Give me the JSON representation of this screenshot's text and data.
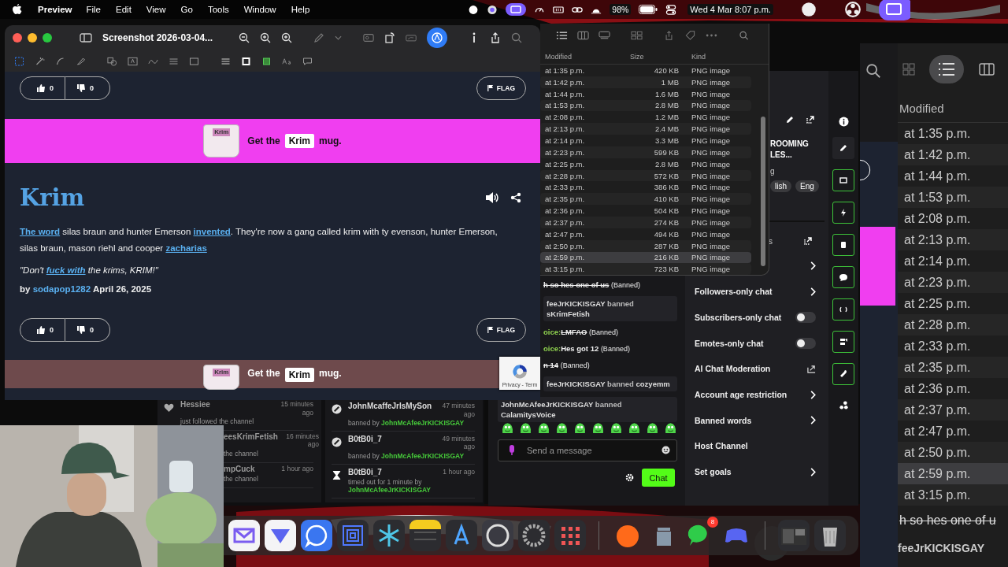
{
  "menubar": {
    "app": "Preview",
    "menus": [
      "File",
      "Edit",
      "View",
      "Go",
      "Tools",
      "Window",
      "Help"
    ],
    "battery": "98%",
    "clock": "Wed 4 Mar  8:07 p.m."
  },
  "preview": {
    "title": "Screenshot 2026-03-04...",
    "top_votes": {
      "up": "0",
      "down": "0",
      "flag": "FLAG"
    },
    "banners": [
      {
        "color": "#f03ef0",
        "lead": "Get the",
        "mug_word": "Krim",
        "word": "Krim",
        "tail": "mug."
      },
      {
        "color": "#6e4a4c",
        "lead": "Get the",
        "mug_word": "Krim",
        "word": "Krim",
        "tail": "mug."
      }
    ],
    "entry": {
      "word": "Krim",
      "definition": [
        {
          "text": "The word",
          "link": true
        },
        {
          "text": " silas braun and hunter Emerson ",
          "link": false
        },
        {
          "text": "invented",
          "link": true
        },
        {
          "text": ". They're now a gang called krim with ty evenson, hunter Emerson, silas braun, mason riehl and cooper ",
          "link": false
        },
        {
          "text": "zacharias",
          "link": true
        }
      ],
      "example": [
        {
          "text": "\"Don't ",
          "link": false
        },
        {
          "text": "fuck with",
          "link": true
        },
        {
          "text": " the krims, KRIM!\"",
          "link": false
        }
      ],
      "by": "by",
      "author": "sodapop1282",
      "date": "April 26, 2025"
    },
    "bottom_votes": {
      "up": "0",
      "down": "0",
      "flag": "FLAG"
    },
    "recaptcha": "Privacy - Term"
  },
  "finder": {
    "columns": [
      "Modified",
      "Size",
      "Kind"
    ],
    "rows": [
      {
        "modified": "at 1:35 p.m.",
        "size": "420 KB",
        "kind": "PNG image",
        "selected": false
      },
      {
        "modified": "at 1:42 p.m.",
        "size": "1 MB",
        "kind": "PNG image",
        "selected": false
      },
      {
        "modified": "at 1:44 p.m.",
        "size": "1.6 MB",
        "kind": "PNG image",
        "selected": false
      },
      {
        "modified": "at 1:53 p.m.",
        "size": "2.8 MB",
        "kind": "PNG image",
        "selected": false
      },
      {
        "modified": "at 2:08 p.m.",
        "size": "1.2 MB",
        "kind": "PNG image",
        "selected": false
      },
      {
        "modified": "at 2:13 p.m.",
        "size": "2.4 MB",
        "kind": "PNG image",
        "selected": false
      },
      {
        "modified": "at 2:14 p.m.",
        "size": "3.3 MB",
        "kind": "PNG image",
        "selected": false
      },
      {
        "modified": "at 2:23 p.m.",
        "size": "599 KB",
        "kind": "PNG image",
        "selected": false
      },
      {
        "modified": "at 2:25 p.m.",
        "size": "2.8 MB",
        "kind": "PNG image",
        "selected": false
      },
      {
        "modified": "at 2:28 p.m.",
        "size": "572 KB",
        "kind": "PNG image",
        "selected": false
      },
      {
        "modified": "at 2:33 p.m.",
        "size": "386 KB",
        "kind": "PNG image",
        "selected": false
      },
      {
        "modified": "at 2:35 p.m.",
        "size": "410 KB",
        "kind": "PNG image",
        "selected": false
      },
      {
        "modified": "at 2:36 p.m.",
        "size": "504 KB",
        "kind": "PNG image",
        "selected": false
      },
      {
        "modified": "at 2:37 p.m.",
        "size": "274 KB",
        "kind": "PNG image",
        "selected": false
      },
      {
        "modified": "at 2:47 p.m.",
        "size": "494 KB",
        "kind": "PNG image",
        "selected": false
      },
      {
        "modified": "at 2:50 p.m.",
        "size": "287 KB",
        "kind": "PNG image",
        "selected": false
      },
      {
        "modified": "at 2:59 p.m.",
        "size": "216 KB",
        "kind": "PNG image",
        "selected": true
      },
      {
        "modified": "at 3:15 p.m.",
        "size": "723 KB",
        "kind": "PNG image",
        "selected": false
      }
    ]
  },
  "stream_info": {
    "title_lines": [
      "ROOMING",
      "LES..."
    ],
    "category": "g",
    "tags": [
      "lish",
      "Eng"
    ],
    "section": "s"
  },
  "settings": [
    {
      "label": "Followers-only chat",
      "kind": "chevron"
    },
    {
      "label": "Subscribers-only chat",
      "kind": "toggle",
      "on": false
    },
    {
      "label": "Emotes-only chat",
      "kind": "toggle",
      "on": false
    },
    {
      "label": "AI Chat Moderation",
      "kind": "external"
    },
    {
      "label": "Account age restriction",
      "kind": "chevron"
    },
    {
      "label": "Banned words",
      "kind": "chevron"
    },
    {
      "label": "Host Channel",
      "kind": "plain"
    },
    {
      "label": "Set goals",
      "kind": "chevron"
    }
  ],
  "chat": {
    "lines": [
      {
        "kind": "message",
        "text": "h so hes one of us",
        "struck": true,
        "note": "(Banned)"
      },
      {
        "kind": "mod",
        "actor": "feeJrKICKISGAY",
        "verb": "banned",
        "target": "sKrimFetish"
      },
      {
        "kind": "message",
        "user": "oice:",
        "text": "LMFAO",
        "struck": true,
        "note": "(Banned)"
      },
      {
        "kind": "message",
        "user": "oice:",
        "text": "Hes got 12",
        "struck": false,
        "note": "(Banned)"
      },
      {
        "kind": "message",
        "text": "n 14",
        "struck": true,
        "note": "(Banned)"
      },
      {
        "kind": "mod",
        "actor": "feeJrKICKISGAY",
        "verb": "banned",
        "target": "cozyemm"
      },
      {
        "kind": "mod",
        "actor": "JohnMcAfeeJrKICKISGAY",
        "verb": "banned",
        "target": "CalamitysVoice"
      }
    ],
    "placeholder": "Send a message",
    "send": "Chat"
  },
  "feed_left": [
    {
      "kind": "follow",
      "name": "Hessiee",
      "time": "15 minutes ago",
      "action": "just followed the channel"
    },
    {
      "name": "eesKrimFetish",
      "time": "16 minutes ago",
      "action": "the channel"
    },
    {
      "name": "mpCuck",
      "time": "1 hour ago",
      "action": "the channel"
    }
  ],
  "feed_right": [
    {
      "kind": "ban",
      "name": "JohnMcaffeJrIsMySon",
      "time": "47 minutes ago",
      "action": "banned by",
      "by": "JohnMcAfeeJrKICKISGAY"
    },
    {
      "kind": "ban",
      "name": "B0tB0i_7",
      "time": "49 minutes ago",
      "action": "banned by",
      "by": "JohnMcAfeeJrKICKISGAY"
    },
    {
      "kind": "timeout",
      "name": "B0tB0i_7",
      "time": "1 hour ago",
      "action": "timed out for 1 minute by",
      "by": "JohnMcAfeeJrKICKISGAY"
    }
  ],
  "dock": {
    "badge": "8"
  },
  "right_finder": {
    "header": "Modified",
    "rows": [
      {
        "text": "at 1:35 p.m.",
        "selected": false
      },
      {
        "text": "at 1:42 p.m.",
        "selected": false
      },
      {
        "text": "at 1:44 p.m.",
        "selected": false
      },
      {
        "text": "at 1:53 p.m.",
        "selected": false
      },
      {
        "text": "at 2:08 p.m.",
        "selected": false
      },
      {
        "text": "at 2:13 p.m.",
        "selected": false
      },
      {
        "text": "at 2:14 p.m.",
        "selected": false
      },
      {
        "text": "at 2:23 p.m.",
        "selected": false
      },
      {
        "text": "at 2:25 p.m.",
        "selected": false
      },
      {
        "text": "at 2:28 p.m.",
        "selected": false
      },
      {
        "text": "at 2:33 p.m.",
        "selected": false
      },
      {
        "text": "at 2:35 p.m.",
        "selected": false
      },
      {
        "text": "at 2:36 p.m.",
        "selected": false
      },
      {
        "text": "at 2:37 p.m.",
        "selected": false
      },
      {
        "text": "at 2:47 p.m.",
        "selected": false
      },
      {
        "text": "at 2:50 p.m.",
        "selected": false
      },
      {
        "text": "at 2:59 p.m.",
        "selected": true
      },
      {
        "text": "at 3:15 p.m.",
        "selected": false
      }
    ],
    "struck_line": "h so hes one of u",
    "last_line": "feeJrKICKISGAY"
  }
}
